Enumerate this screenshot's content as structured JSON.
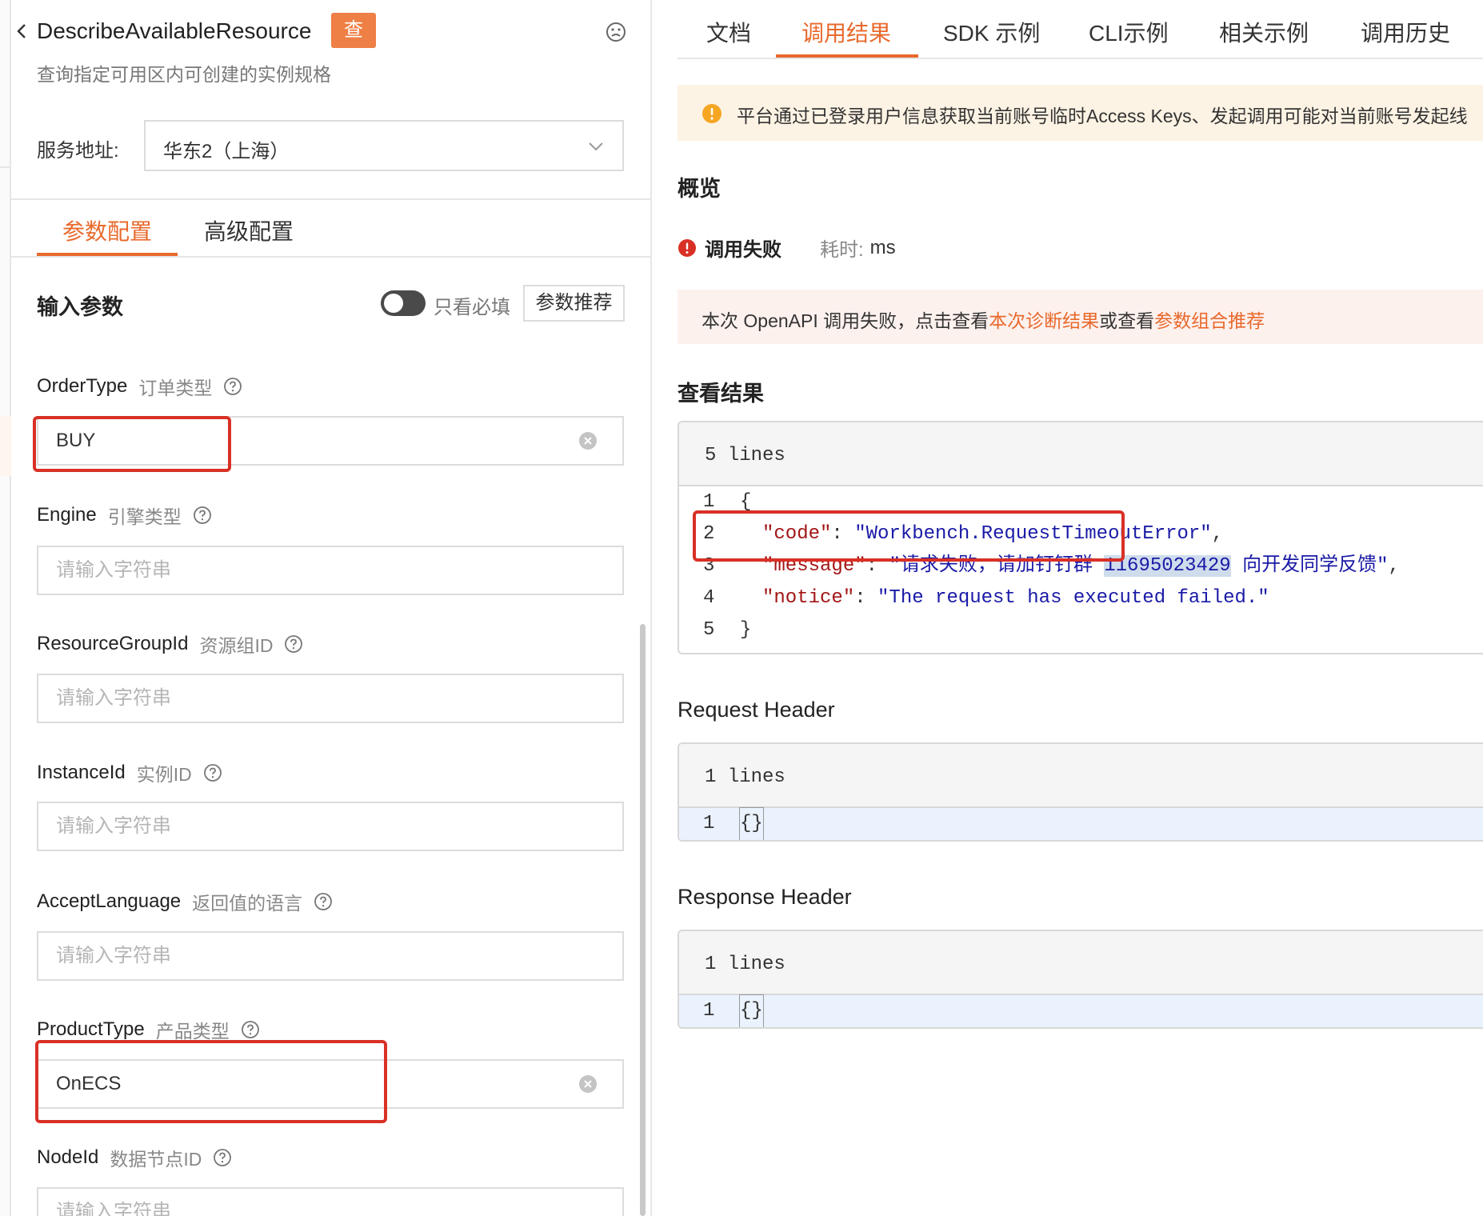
{
  "left": {
    "api_name": "DescribeAvailableResource",
    "api_badge": "查",
    "api_desc": "查询指定可用区内可创建的实例规格",
    "service_label": "服务地址:",
    "service_value": "华东2（上海）",
    "tabs": [
      {
        "label": "参数配置",
        "active": true
      },
      {
        "label": "高级配置",
        "active": false
      }
    ],
    "input_section_title": "输入参数",
    "toggle_label": "只看必填",
    "recommend_button": "参数推荐",
    "params": [
      {
        "name": "OrderType",
        "cn": "订单类型",
        "value": "BUY",
        "placeholder": "请输入字符串"
      },
      {
        "name": "Engine",
        "cn": "引擎类型",
        "value": "",
        "placeholder": "请输入字符串"
      },
      {
        "name": "ResourceGroupId",
        "cn": "资源组ID",
        "value": "",
        "placeholder": "请输入字符串"
      },
      {
        "name": "InstanceId",
        "cn": "实例ID",
        "value": "",
        "placeholder": "请输入字符串"
      },
      {
        "name": "AcceptLanguage",
        "cn": "返回值的语言",
        "value": "",
        "placeholder": "请输入字符串"
      },
      {
        "name": "ProductType",
        "cn": "产品类型",
        "value": "OnECS",
        "placeholder": "请输入字符串"
      },
      {
        "name": "NodeId",
        "cn": "数据节点ID",
        "value": "",
        "placeholder": "请输入字符串"
      }
    ]
  },
  "right": {
    "tabs": [
      {
        "label": "文档",
        "active": false
      },
      {
        "label": "调用结果",
        "active": true
      },
      {
        "label": "SDK 示例",
        "active": false
      },
      {
        "label": "CLI示例",
        "active": false
      },
      {
        "label": "相关示例",
        "active": false
      },
      {
        "label": "调用历史",
        "active": false
      }
    ],
    "notice": "平台通过已登录用户信息获取当前账号临时Access Keys、发起调用可能对当前账号发起线",
    "overview_title": "概览",
    "status_text": "调用失败",
    "elapsed_label": "耗时:",
    "elapsed_value": "ms",
    "fail_prefix": "本次 OpenAPI 调用失败，点击查看",
    "fail_link1": "本次诊断结果",
    "fail_mid": "或查看",
    "fail_link2": "参数组合推荐",
    "result_title": "查看结果",
    "result_lines_label": "5 lines",
    "result_code": {
      "line_numbers": [
        "1",
        "2",
        "3",
        "4",
        "5"
      ],
      "open": "{",
      "code_key": "\"code\"",
      "code_value": "\"Workbench.RequestTimeoutError\"",
      "message_key": "\"message\"",
      "message_value_a": "\"请求失败，请加钉钉群 ",
      "message_value_num": "11695023429",
      "message_value_b": " 向开发同学反馈\"",
      "notice_key": "\"notice\"",
      "notice_value": "\"The request has executed failed.\"",
      "close": "}"
    },
    "request_header_title": "Request Header",
    "request_lines_label": "1 lines",
    "request_line_no": "1",
    "request_body": "{}",
    "response_header_title": "Response Header",
    "response_lines_label": "1 lines",
    "response_line_no": "1",
    "response_body": "{}"
  },
  "colors": {
    "accent": "#e8692c",
    "error": "#d93026",
    "warning_bg": "#fdf3e4"
  }
}
